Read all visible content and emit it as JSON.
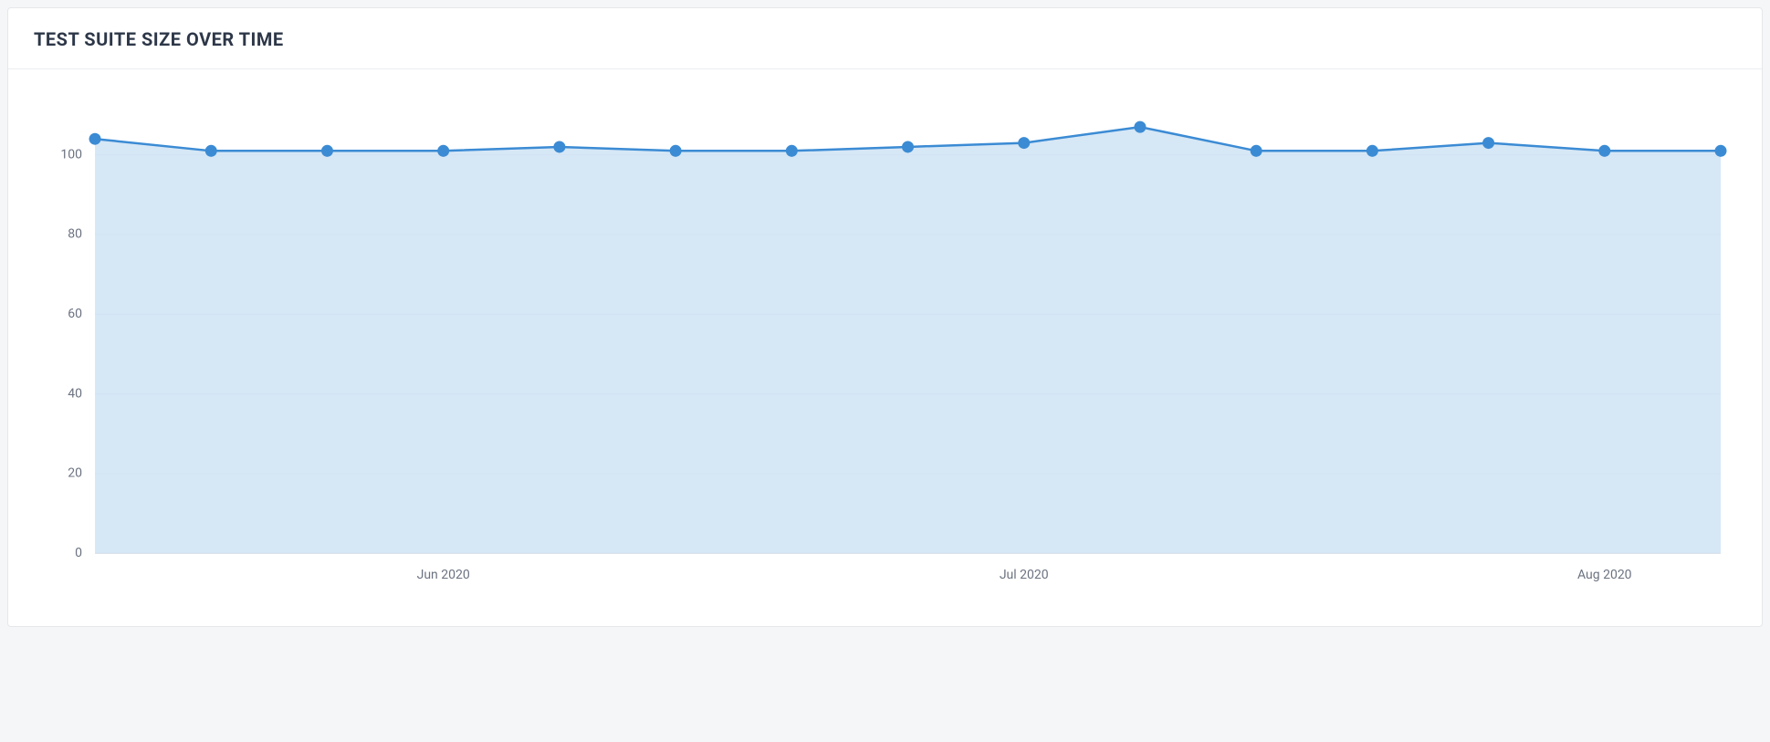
{
  "header": {
    "title": "TEST SUITE SIZE OVER TIME"
  },
  "chart_data": {
    "type": "area",
    "title": "Test Suite Size Over Time",
    "xlabel": "",
    "ylabel": "",
    "ylim": [
      0,
      110
    ],
    "y_ticks": [
      0,
      20,
      40,
      60,
      80,
      100
    ],
    "x_tick_labels": [
      "Jun 2020",
      "Jul 2020",
      "Aug 2020"
    ],
    "x_tick_positions": [
      3,
      8,
      13
    ],
    "x": [
      0,
      1,
      2,
      3,
      4,
      5,
      6,
      7,
      8,
      9,
      10,
      11,
      12,
      13,
      14
    ],
    "values": [
      104,
      101,
      101,
      101,
      102,
      101,
      101,
      102,
      103,
      107,
      101,
      101,
      103,
      101,
      101
    ],
    "colors": {
      "line": "#3b8bd4",
      "fill": "#cfe3f5"
    }
  }
}
